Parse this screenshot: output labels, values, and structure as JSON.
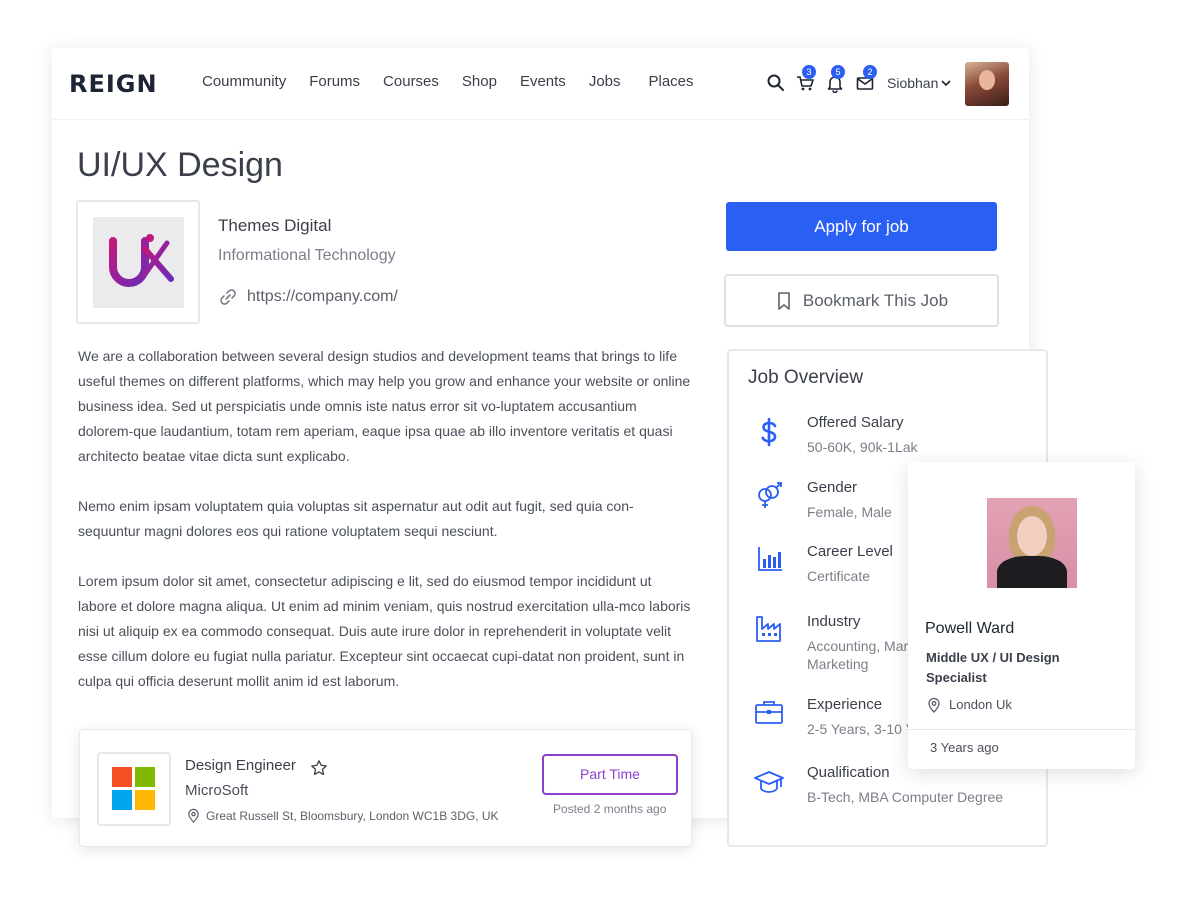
{
  "header": {
    "logo": "REIGN",
    "nav": [
      "Coummunity",
      "Forums",
      "Courses",
      "Shop",
      "Events",
      "Jobs",
      "Places"
    ],
    "cart_count": "3",
    "notification_count": "5",
    "message_count": "2",
    "username": "Siobhan"
  },
  "job": {
    "title": "UI/UX Design",
    "company": "Themes Digital",
    "sector": "Informational Technology",
    "url": "https://company.com/",
    "description": [
      "We are a collaboration between several design studios and development teams that brings to life useful themes on different platforms, which may help you grow and enhance your website or online business idea. Sed ut perspiciatis unde omnis iste natus error sit vo-luptatem accusantium dolorem-que laudantium, totam rem aperiam, eaque ipsa quae ab illo inventore veritatis et quasi architecto beatae vitae dicta sunt explicabo.",
      "Nemo enim ipsam voluptatem quia voluptas sit aspernatur aut odit aut fugit, sed quia con-sequuntur magni dolores eos qui ratione voluptatem sequi nesciunt.",
      "Lorem ipsum dolor sit amet, consectetur adipiscing e lit, sed do eiusmod tempor incididunt ut labore et dolore magna aliqua. Ut enim ad minim veniam, quis nostrud exercitation ulla-mco laboris nisi ut aliquip ex ea commodo consequat. Duis aute irure dolor in reprehenderit in voluptate velit esse cillum dolore eu fugiat nulla pariatur. Excepteur sint occaecat cupi-datat non proident, sunt in culpa qui officia deserunt mollit anim id est laborum."
    ],
    "apply_label": "Apply for job",
    "bookmark_label": "Bookmark This Job"
  },
  "overview": {
    "title": "Job Overview",
    "items": [
      {
        "icon": "dollar-icon",
        "label": "Offered Salary",
        "value": "50-60K, 90k-1Lak"
      },
      {
        "icon": "gender-icon",
        "label": "Gender",
        "value": "Female, Male"
      },
      {
        "icon": "bar-chart-icon",
        "label": "Career Level",
        "value": "Certificate"
      },
      {
        "icon": "factory-icon",
        "label": "Industry",
        "value": "Accounting, Mar",
        "value2": "Marketing"
      },
      {
        "icon": "briefcase-icon",
        "label": "Experience",
        "value": "2-5 Years, 3-10 Y"
      },
      {
        "icon": "graduation-cap-icon",
        "label": "Qualification",
        "value": "B-Tech, MBA Computer Degree"
      }
    ]
  },
  "profile": {
    "name": "Powell Ward",
    "role": "Middle UX / UI Design Specialist",
    "location": "London Uk",
    "time": "3 Years ago"
  },
  "job_card": {
    "title": "Design Engineer",
    "company": "MicroSoft",
    "address": "Great Russell St, Bloomsbury, London WC1B 3DG, UK",
    "type_label": "Part Time",
    "posted": "Posted 2 months ago"
  },
  "colors": {
    "accent": "#2a5ff4",
    "purple": "#8d3fc9",
    "icon_blue": "#2b5ef5"
  }
}
